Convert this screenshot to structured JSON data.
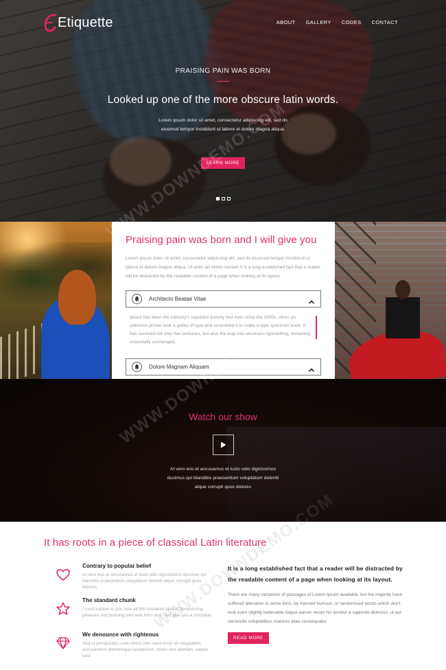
{
  "nav": {
    "logo_text": "Etiquette",
    "menu": [
      "ABOUT",
      "GALLERY",
      "CODES",
      "CONTACT"
    ]
  },
  "hero": {
    "kicker": "PRAISING PAIN WAS BORN",
    "title": "Looked up one of the more obscure latin words.",
    "text": "Lorem ipsum dolor sit amet, consectetur adipiscing elit, sed do eiusmod tempor incididunt ut labore et dolore magna aliqua.",
    "button": "LEARN MORE",
    "slides": 3,
    "active_slide": 1
  },
  "about": {
    "title": "Praising pain was born and I will give you",
    "text": "Lorem ipsum dolor sit amet, consectetur adipiscing elit, sed do eiusmod tempor incididunt ut labore et dolore magna aliqua. Ut enim ad minim veniam it is a long established fact that a reader will be distracted by the readable content of a page when looking at its layout.",
    "accordion": [
      {
        "label": "Architecto Beatae Vitae",
        "body": "Ipsum has been the industry's standard dummy text ever since the 1500s, when an unknown printer took a galley of type and scrambled it to make a type specimen book. It has survived not only five centuries, but also the leap into electronic typesetting, remaining essentially unchanged.",
        "open": true
      },
      {
        "label": "Dolore Magnam Aliquam",
        "open": false
      }
    ]
  },
  "video": {
    "title": "Watch our show",
    "text": "At vero eos et accusamus et iusto odio dignissimos ducimus qui blanditiis praesentium voluptatum deleniti atque corrupti quos dolores"
  },
  "features": {
    "title": "It has roots in a piece of classical Latin literature",
    "items": [
      {
        "icon": "heart-icon",
        "title": "Contrary to popular belief",
        "text": "At vero eos et accusamus et iusto odio dignissimos ducimus qui blanditiis praesentium voluptatum deleniti atque corrupti quos dolores"
      },
      {
        "icon": "star-icon",
        "title": "The standard chunk",
        "text": "I must explain to you how all this mistaken idea of denouncing pleasure and praising pain was born and I will give you a complete"
      },
      {
        "icon": "diamond-icon",
        "title": "We denounce with righteous",
        "text": "Sed ut perspiciatis unde omnis iste natus error sit voluptatem accusantium doloremque laudantium, totam rem aperiam, eaque ipsa"
      }
    ],
    "right_title": "It is a long established fact that a reader will be distracted by the readable content of a page when looking at its layout.",
    "right_text": "There are many variations of passages of Lorem Ipsum available, but the majority have suffered alteration in some form, by injected humour, or randomised words which don't look even slightly believable.Itaque earum rerum hic tenetur a sapiente delectus, ut aut reiciendis voluptatibus maiores alias consequatur.",
    "right_button": "READ MORE"
  },
  "watermark": "WWW.DOWNDEMO.COM",
  "colors": {
    "accent": "#e0245e",
    "heading_pink": "#e0306e"
  }
}
